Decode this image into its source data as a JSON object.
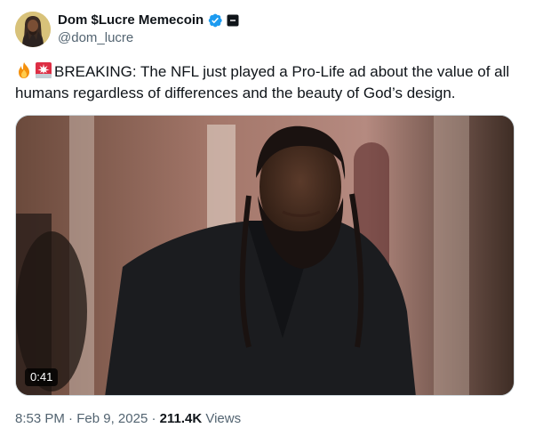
{
  "author": {
    "display_name": "Dom $Lucre Memecoin",
    "handle": "@dom_lucre",
    "verified_icon": "verified-badge-icon",
    "affiliation_icon": "affiliate-badge-icon",
    "verified_color": "#1d9bf0"
  },
  "tweet": {
    "emoji_1": "fire-emoji-icon",
    "emoji_2": "police-light-emoji-icon",
    "text": "BREAKING: The NFL just played a Pro-Life ad about the value of all humans regardless of differences and the beauty of God’s design."
  },
  "media": {
    "type": "video",
    "duration": "0:41"
  },
  "meta": {
    "time": "8:53 PM",
    "separator": "·",
    "date": "Feb 9, 2025",
    "views_count": "211.4K",
    "views_label": "Views"
  },
  "colors": {
    "text_primary": "#0f1419",
    "text_secondary": "#536471",
    "border": "#cfd9de"
  }
}
